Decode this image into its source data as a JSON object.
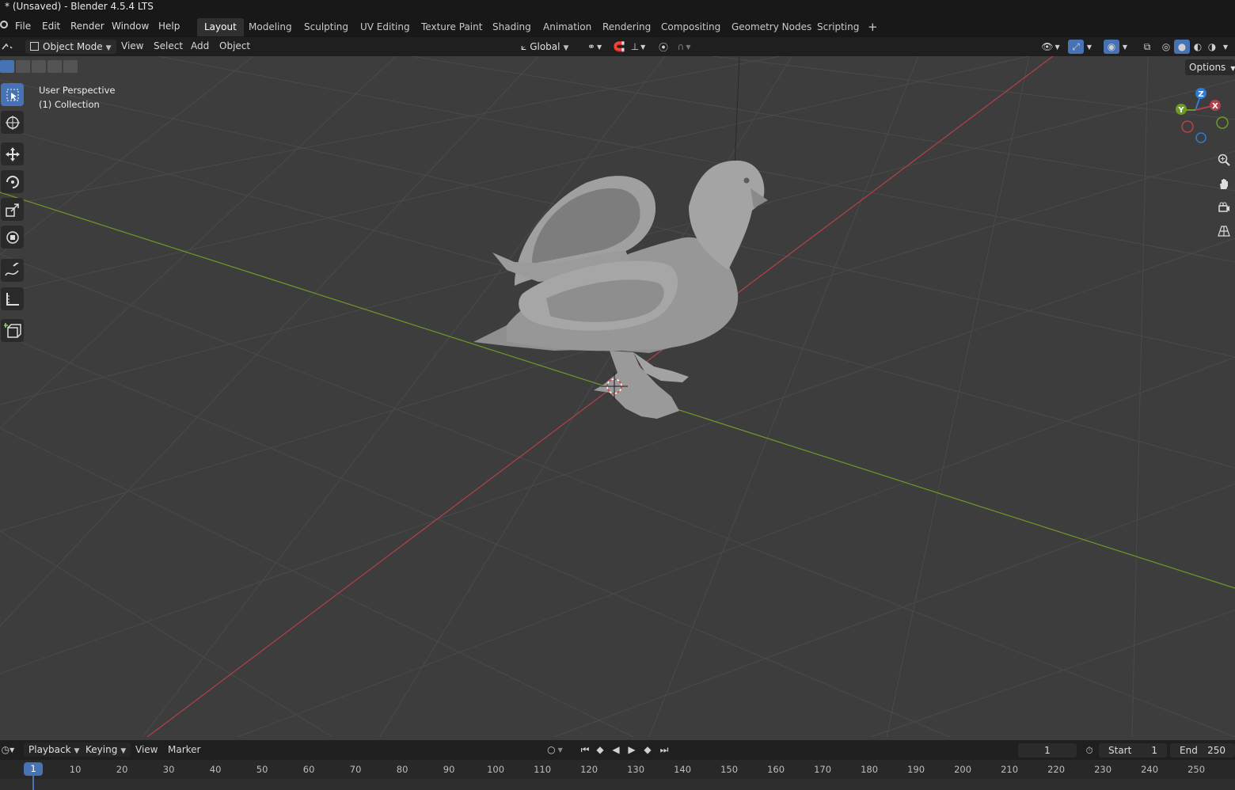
{
  "window": {
    "title": "* (Unsaved) - Blender 4.5.4 LTS"
  },
  "menu": {
    "items": [
      "File",
      "Edit",
      "Render",
      "Window",
      "Help"
    ]
  },
  "workspaces": {
    "tabs": [
      "Layout",
      "Modeling",
      "Sculpting",
      "UV Editing",
      "Texture Paint",
      "Shading",
      "Animation",
      "Rendering",
      "Compositing",
      "Geometry Nodes",
      "Scripting"
    ],
    "active": "Layout",
    "add_icon": "plus-icon"
  },
  "viewport_header": {
    "mode": "Object Mode",
    "menus": [
      "View",
      "Select",
      "Add",
      "Object"
    ],
    "transform_orientation": "Global",
    "options_label": "Options"
  },
  "viewport": {
    "perspective_label": "User Perspective",
    "collection_label": "(1) Collection",
    "gizmo": {
      "x": "X",
      "y": "Y",
      "z": "Z"
    },
    "colors": {
      "x_axis": "#b5404a",
      "y_axis": "#6e9a26",
      "z_axis": "#2f7bd6",
      "background": "#3d3d3d"
    }
  },
  "toolbar": {
    "tools": [
      "select-box-icon",
      "cursor-icon",
      "move-icon",
      "rotate-icon",
      "scale-icon",
      "transform-icon",
      "annotate-icon",
      "measure-icon",
      "add-cube-icon"
    ],
    "active": "select-box-icon"
  },
  "timeline": {
    "menus": [
      "Playback",
      "Keying",
      "View",
      "Marker"
    ],
    "current_frame": "1",
    "start_label": "Start",
    "start": "1",
    "end_label": "End",
    "end": "250",
    "ticks": [
      "10",
      "20",
      "30",
      "40",
      "50",
      "60",
      "70",
      "80",
      "90",
      "100",
      "110",
      "120",
      "130",
      "140",
      "150",
      "160",
      "170",
      "180",
      "190",
      "200",
      "210",
      "220",
      "230",
      "240",
      "250"
    ],
    "playhead_frame": "1"
  }
}
